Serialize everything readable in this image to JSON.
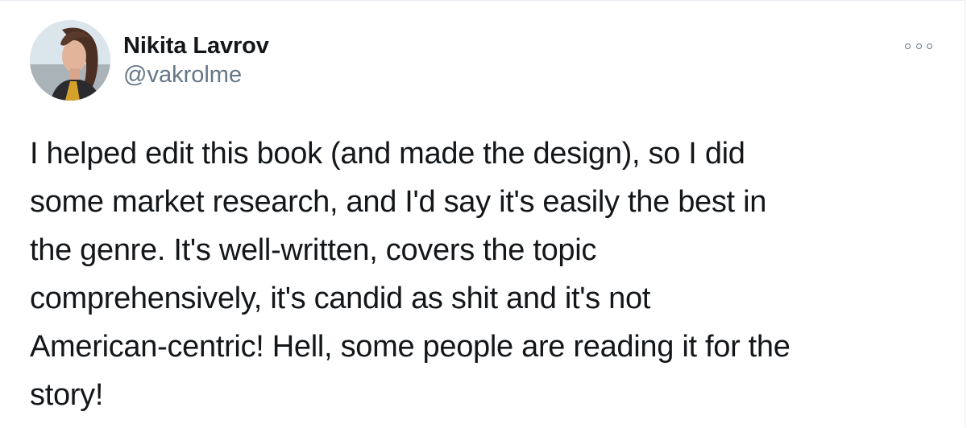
{
  "tweet": {
    "author": {
      "display_name": "Nikita Lavrov",
      "handle": "@vakrolme",
      "avatar_icon": "profile-photo"
    },
    "more_icon": "more-options-icon",
    "text_lines": [
      "I helped edit this book (and made the design), so I did",
      "some market research, and I'd say it's easily the best in",
      "the genre. It's well-written, covers the topic",
      "comprehensively, it's candid as shit and it's not",
      "American-centric! Hell, some people are reading it for the",
      "story!"
    ]
  },
  "colors": {
    "text": "#14171a",
    "secondary": "#657786",
    "border": "#e6ecf0",
    "background": "#ffffff"
  }
}
